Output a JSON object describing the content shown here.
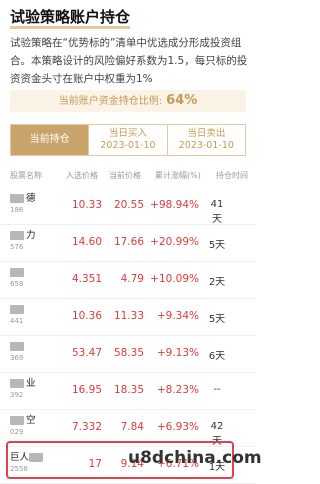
{
  "page": {
    "title": "试验策略账户持仓",
    "description": "试验策略在“优势标的”清单中优选成分形成投资组合。本策略设计的风险偏好系数为1.5，每只标的投资资金头寸在账户中权重为1%"
  },
  "ratio": {
    "label": "当前账户资金持仓比例:",
    "value": "64%"
  },
  "tabs": [
    {
      "label": "当前持仓",
      "date": ""
    },
    {
      "label": "当日买入",
      "date": "2023-01-10"
    },
    {
      "label": "当日卖出",
      "date": "2023-01-10"
    }
  ],
  "columns": [
    "股票名称",
    "入选价格",
    "当前价格",
    "累计涨幅(%)",
    "持仓时间"
  ],
  "rows": [
    {
      "name": "德",
      "code": "186",
      "entry": "10.33",
      "current": "20.55",
      "change": "+98.94%",
      "days": "41天"
    },
    {
      "name": "力",
      "code": "576",
      "entry": "14.60",
      "current": "17.66",
      "change": "+20.99%",
      "days": "5天"
    },
    {
      "name": "",
      "code": "658",
      "entry": "4.351",
      "current": "4.79",
      "change": "+10.09%",
      "days": "2天"
    },
    {
      "name": "",
      "code": "441",
      "entry": "10.36",
      "current": "11.33",
      "change": "+9.34%",
      "days": "5天"
    },
    {
      "name": "",
      "code": "369",
      "entry": "53.47",
      "current": "58.35",
      "change": "+9.13%",
      "days": "6天"
    },
    {
      "name": "业",
      "code": "392",
      "entry": "16.95",
      "current": "18.35",
      "change": "+8.23%",
      "days": "--"
    },
    {
      "name": "空",
      "code": "029",
      "entry": "7.332",
      "current": "7.84",
      "change": "+6.93%",
      "days": "42天"
    },
    {
      "name": "巨人",
      "code": "2558",
      "entry": "17",
      "current": "9.14",
      "change": "+6.71%",
      "days": "1天"
    }
  ],
  "watermark": "u8dchina.com"
}
